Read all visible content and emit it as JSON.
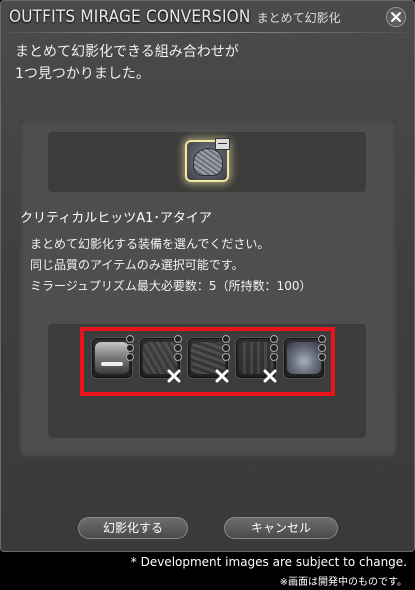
{
  "window": {
    "title": "OUTFITS MIRAGE CONVERSION",
    "subtitle": "まとめて幻影化",
    "close_icon": "close-icon"
  },
  "message": {
    "line1": "まとめて幻影化できる組み合わせが",
    "line2": "1つ見つかりました。"
  },
  "selected_item": {
    "name": "クリティカルヒッツA1･アタイア",
    "icon": "helmet-icon"
  },
  "instructions": {
    "line1": "まとめて幻影化する装備を選んでください。",
    "line2": "同じ品質のアイテムのみ選択可能です。",
    "line3": "ミラージュプリズム最大必要数：5（所持数：100）"
  },
  "gear_slots": [
    {
      "icon": "head-gear-icon",
      "available": true
    },
    {
      "icon": "body-gear-icon",
      "available": false
    },
    {
      "icon": "hands-gear-icon",
      "available": false
    },
    {
      "icon": "legs-gear-icon",
      "available": false
    },
    {
      "icon": "feet-gear-icon",
      "available": true
    }
  ],
  "buttons": {
    "confirm": "幻影化する",
    "cancel": "キャンセル"
  },
  "footer": {
    "disclaimer_en": "* Development images are subject to change.",
    "disclaimer_jp": "※画面は開発中のものです。"
  },
  "colors": {
    "highlight_border": "#e8131b",
    "selected_glow": "#f3eaa0"
  }
}
